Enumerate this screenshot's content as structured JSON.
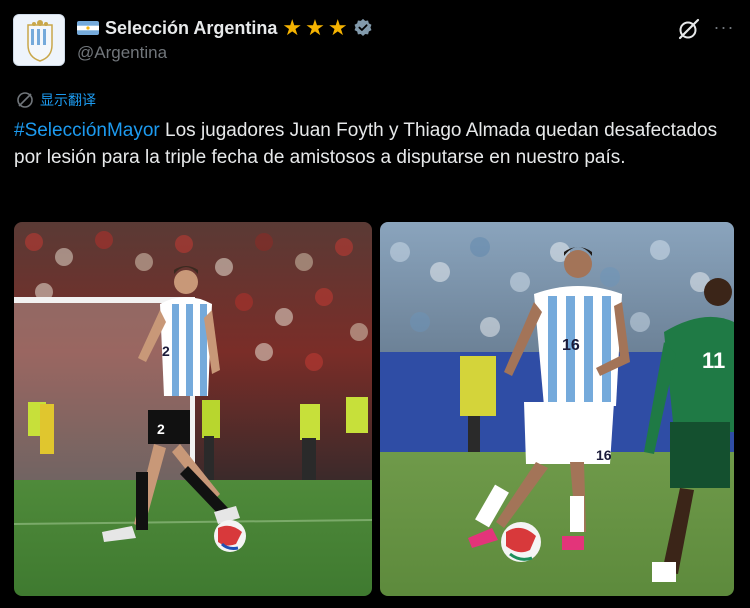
{
  "account": {
    "display_name": "Selección Argentina",
    "handle": "@Argentina",
    "stars": [
      "★",
      "★",
      "★"
    ],
    "verified_icon": "verified-badge-icon",
    "flag_icon": "argentina-flag-icon"
  },
  "header_actions": {
    "grok_icon": "grok-icon",
    "more_label": "···"
  },
  "translate": {
    "label": "显示翻译",
    "icon": "globe-icon"
  },
  "tweet": {
    "hashtag": "#SelecciónMayor",
    "text": " Los jugadores Juan Foyth y Thiago Almada quedan desafectados por lesión para la triple fecha de amistosos a disputarse en nuestro país."
  },
  "media": {
    "photo_1": {
      "jersey_number": "2"
    },
    "photo_2": {
      "jersey_number": "16",
      "opponent_number": "11"
    }
  },
  "colors": {
    "background": "#000000",
    "link": "#1d9bf0",
    "text": "#e7e9ea",
    "muted": "#71767b",
    "star": "#f5b301"
  }
}
